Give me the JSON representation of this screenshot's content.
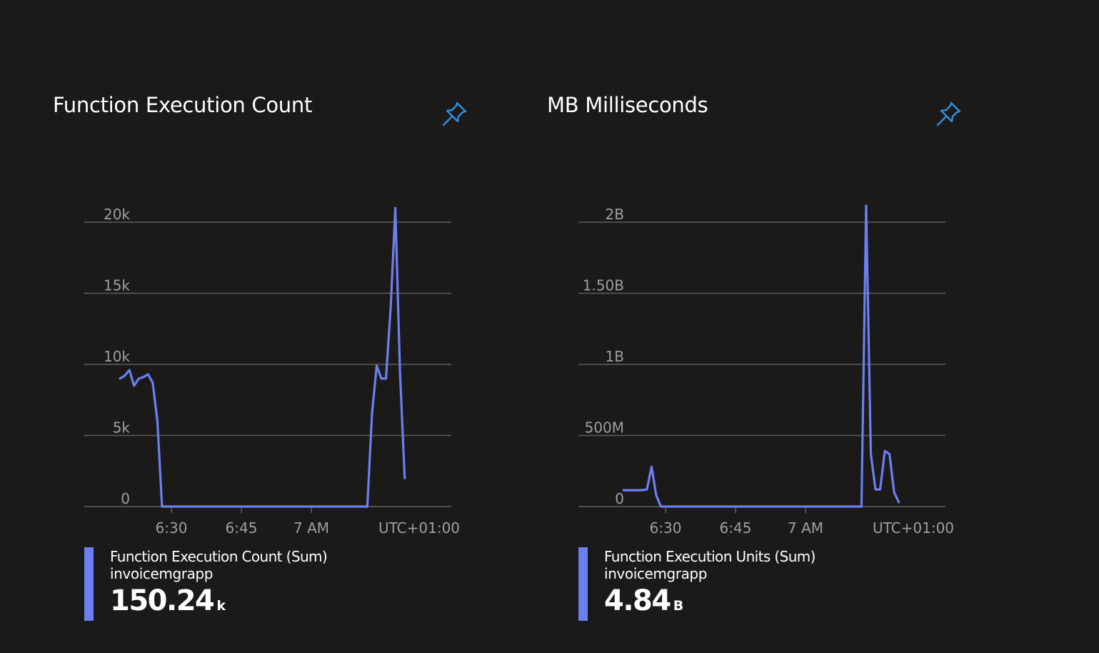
{
  "colors": {
    "background": "#1b1a19",
    "series": "#6b7ff2",
    "grid": "#5e5e5e",
    "tick": "#a19f9d",
    "pin": "#2f8fe0"
  },
  "cards": [
    {
      "title": "Function Execution Count",
      "pin_icon": "pin-icon",
      "legend": {
        "series": "Function Execution Count (Sum)",
        "resource": "invoicemgrapp",
        "value": "150.24",
        "unit": "k"
      }
    },
    {
      "title": "MB Milliseconds",
      "pin_icon": "pin-icon",
      "legend": {
        "series": "Function Execution Units (Sum)",
        "resource": "invoicemgrapp",
        "value": "4.84",
        "unit": "B"
      }
    }
  ],
  "chart_data": [
    {
      "type": "line",
      "title": "Function Execution Count",
      "x_ticks": [
        "6:30",
        "6:45",
        "7 AM",
        "UTC+01:00"
      ],
      "y_ticks": [
        "0",
        "5k",
        "10k",
        "15k",
        "20k"
      ],
      "ylim": [
        0,
        20000
      ],
      "grid": true,
      "series": [
        {
          "name": "Function Execution Count (Sum)",
          "x": [
            "6:19",
            "6:20",
            "6:21",
            "6:22",
            "6:23",
            "6:24",
            "6:25",
            "6:26",
            "6:27",
            "6:28",
            "6:29",
            "6:30",
            "6:31",
            "6:45",
            "7:00",
            "7:12",
            "7:13",
            "7:14",
            "7:15",
            "7:16",
            "7:17",
            "7:18",
            "7:19",
            "7:20"
          ],
          "y": [
            9000,
            9200,
            9600,
            8500,
            9000,
            9100,
            9300,
            8700,
            6000,
            0,
            0,
            0,
            0,
            0,
            0,
            0,
            6500,
            9900,
            9000,
            9000,
            14000,
            21000,
            9500,
            2000
          ]
        }
      ]
    },
    {
      "type": "line",
      "title": "MB Milliseconds",
      "x_ticks": [
        "6:30",
        "6:45",
        "7 AM",
        "UTC+01:00"
      ],
      "y_ticks": [
        "0",
        "500M",
        "1B",
        "1.50B",
        "2B"
      ],
      "ylim": [
        0,
        2000000000
      ],
      "grid": true,
      "series": [
        {
          "name": "Function Execution Units (Sum)",
          "x": [
            "6:21",
            "6:22",
            "6:23",
            "6:24",
            "6:25",
            "6:26",
            "6:27",
            "6:28",
            "6:29",
            "6:30",
            "6:31",
            "6:45",
            "7:00",
            "7:12",
            "7:13",
            "7:14",
            "7:15",
            "7:16",
            "7:17",
            "7:18",
            "7:19",
            "7:20"
          ],
          "y": [
            115000000,
            115000000,
            115000000,
            115000000,
            115000000,
            120000000,
            280000000,
            80000000,
            0,
            0,
            0,
            0,
            0,
            0,
            2250000000,
            370000000,
            120000000,
            120000000,
            390000000,
            370000000,
            100000000,
            30000000
          ]
        }
      ]
    }
  ]
}
